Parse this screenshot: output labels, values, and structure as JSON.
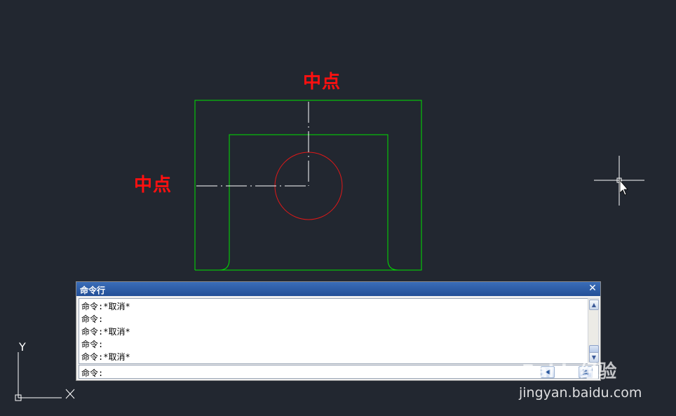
{
  "colors": {
    "background": "#222730",
    "part_outline": "#00e000",
    "hole": "#e01818",
    "centerline": "#ffffff",
    "annotation": "#ff1010",
    "command_titlebar": "#2c5aa0"
  },
  "annotations": {
    "top_label": "中点",
    "left_label": "中点"
  },
  "command_window": {
    "title": "命令行",
    "close_icon": "close-icon",
    "history": [
      "命令:*取消*",
      "命令:",
      "命令:*取消*",
      "命令:",
      "命令:*取消*"
    ],
    "prompt": "命令:",
    "input_value": ""
  },
  "ucs": {
    "y_label": "Y",
    "x_label": "X"
  },
  "watermark": {
    "logo": "Baidu经验",
    "url": "jingyan.baidu.com"
  }
}
